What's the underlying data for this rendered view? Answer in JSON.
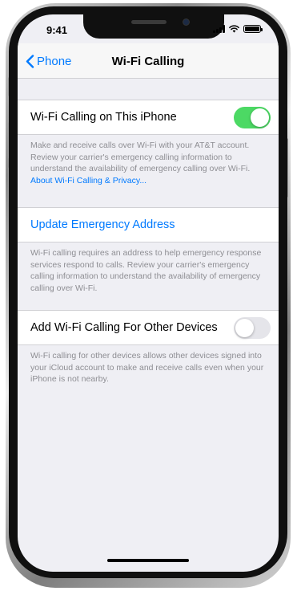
{
  "status_bar": {
    "time": "9:41"
  },
  "nav": {
    "back_label": "Phone",
    "title": "Wi-Fi Calling"
  },
  "wifi_calling": {
    "label": "Wi-Fi Calling on This iPhone",
    "enabled": true,
    "footer_text": "Make and receive calls over Wi-Fi with your AT&T account. Review your carrier's emergency calling information to understand the availability of emergency calling over Wi-Fi. ",
    "footer_link": "About Wi-Fi Calling & Privacy..."
  },
  "emergency": {
    "link_label": "Update Emergency Address",
    "footer_text": "Wi-Fi calling requires an address to help emergency response services respond to calls. Review your carrier's emergency calling information to understand the availability of emergency calling over Wi-Fi."
  },
  "other_devices": {
    "label": "Add Wi-Fi Calling For Other Devices",
    "enabled": false,
    "footer_text": "Wi-Fi calling for other devices allows other devices signed into your iCloud account to make and receive calls even when your iPhone is not nearby."
  },
  "colors": {
    "accent": "#007aff",
    "toggle_on": "#4cd964",
    "background": "#efeff4"
  }
}
